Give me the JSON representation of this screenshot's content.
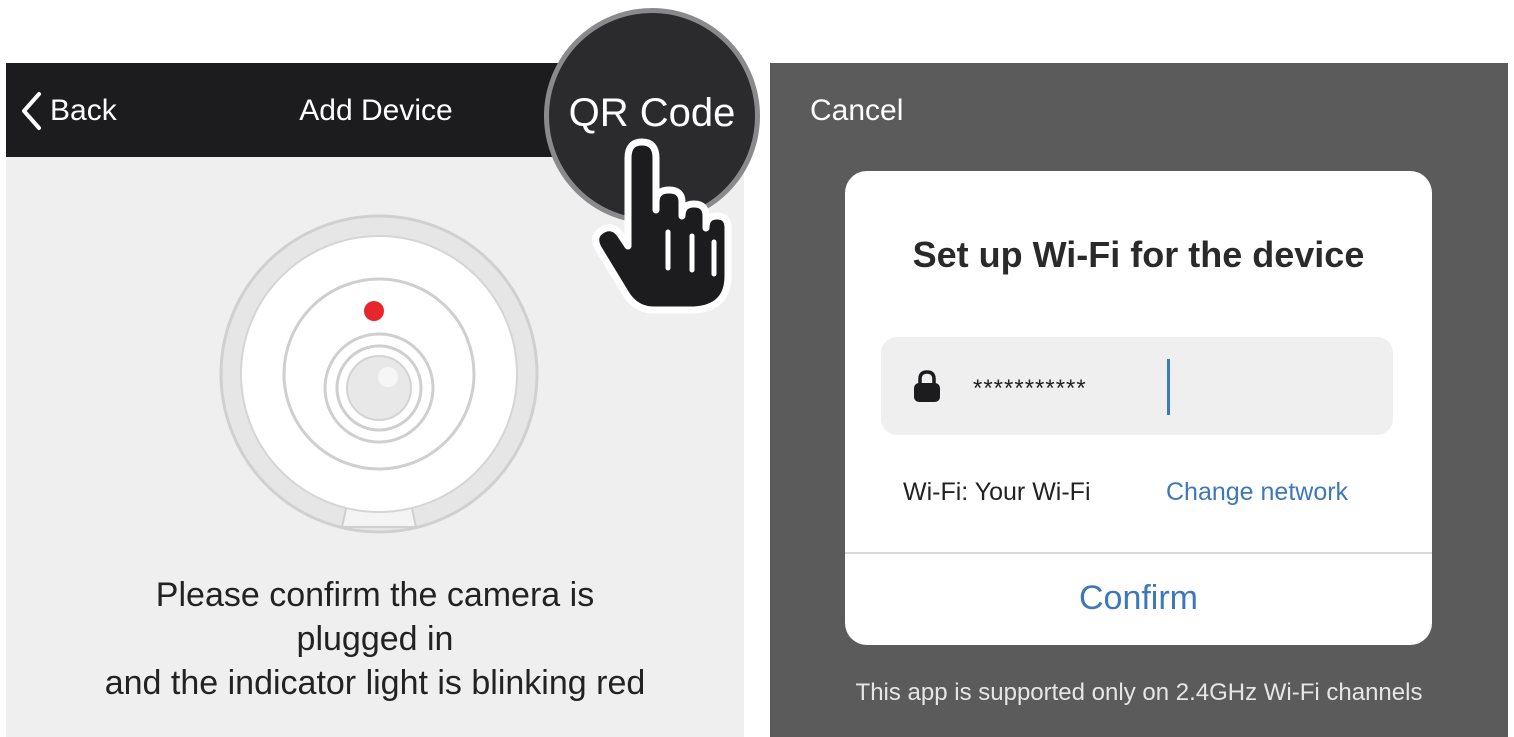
{
  "add_device_screen": {
    "back_label": "Back",
    "title": "Add Device",
    "qr_code_label": "QR Code",
    "instruction_lines": [
      "Please confirm the camera is",
      "plugged in",
      "and the indicator light is blinking red"
    ],
    "indicator_color": "#e8252a"
  },
  "wifi_setup_screen": {
    "cancel_label": "Cancel",
    "dialog": {
      "title": "Set up Wi-Fi for the device",
      "password_value": "***********",
      "network_label": "Wi-Fi: Your Wi-Fi",
      "change_network_label": "Change network",
      "confirm_label": "Confirm"
    },
    "support_note": "This app is supported only on 2.4GHz Wi-Fi channels"
  },
  "colors": {
    "nav_bar": "#1c1c1e",
    "screen_bg": "#efefef",
    "overlay_bg": "#5b5b5b",
    "link_blue": "#3d78b8"
  },
  "icons": [
    "chevron-left-icon",
    "camera-icon",
    "indicator-light-icon",
    "hand-pointer-icon",
    "lock-icon",
    "text-cursor"
  ]
}
